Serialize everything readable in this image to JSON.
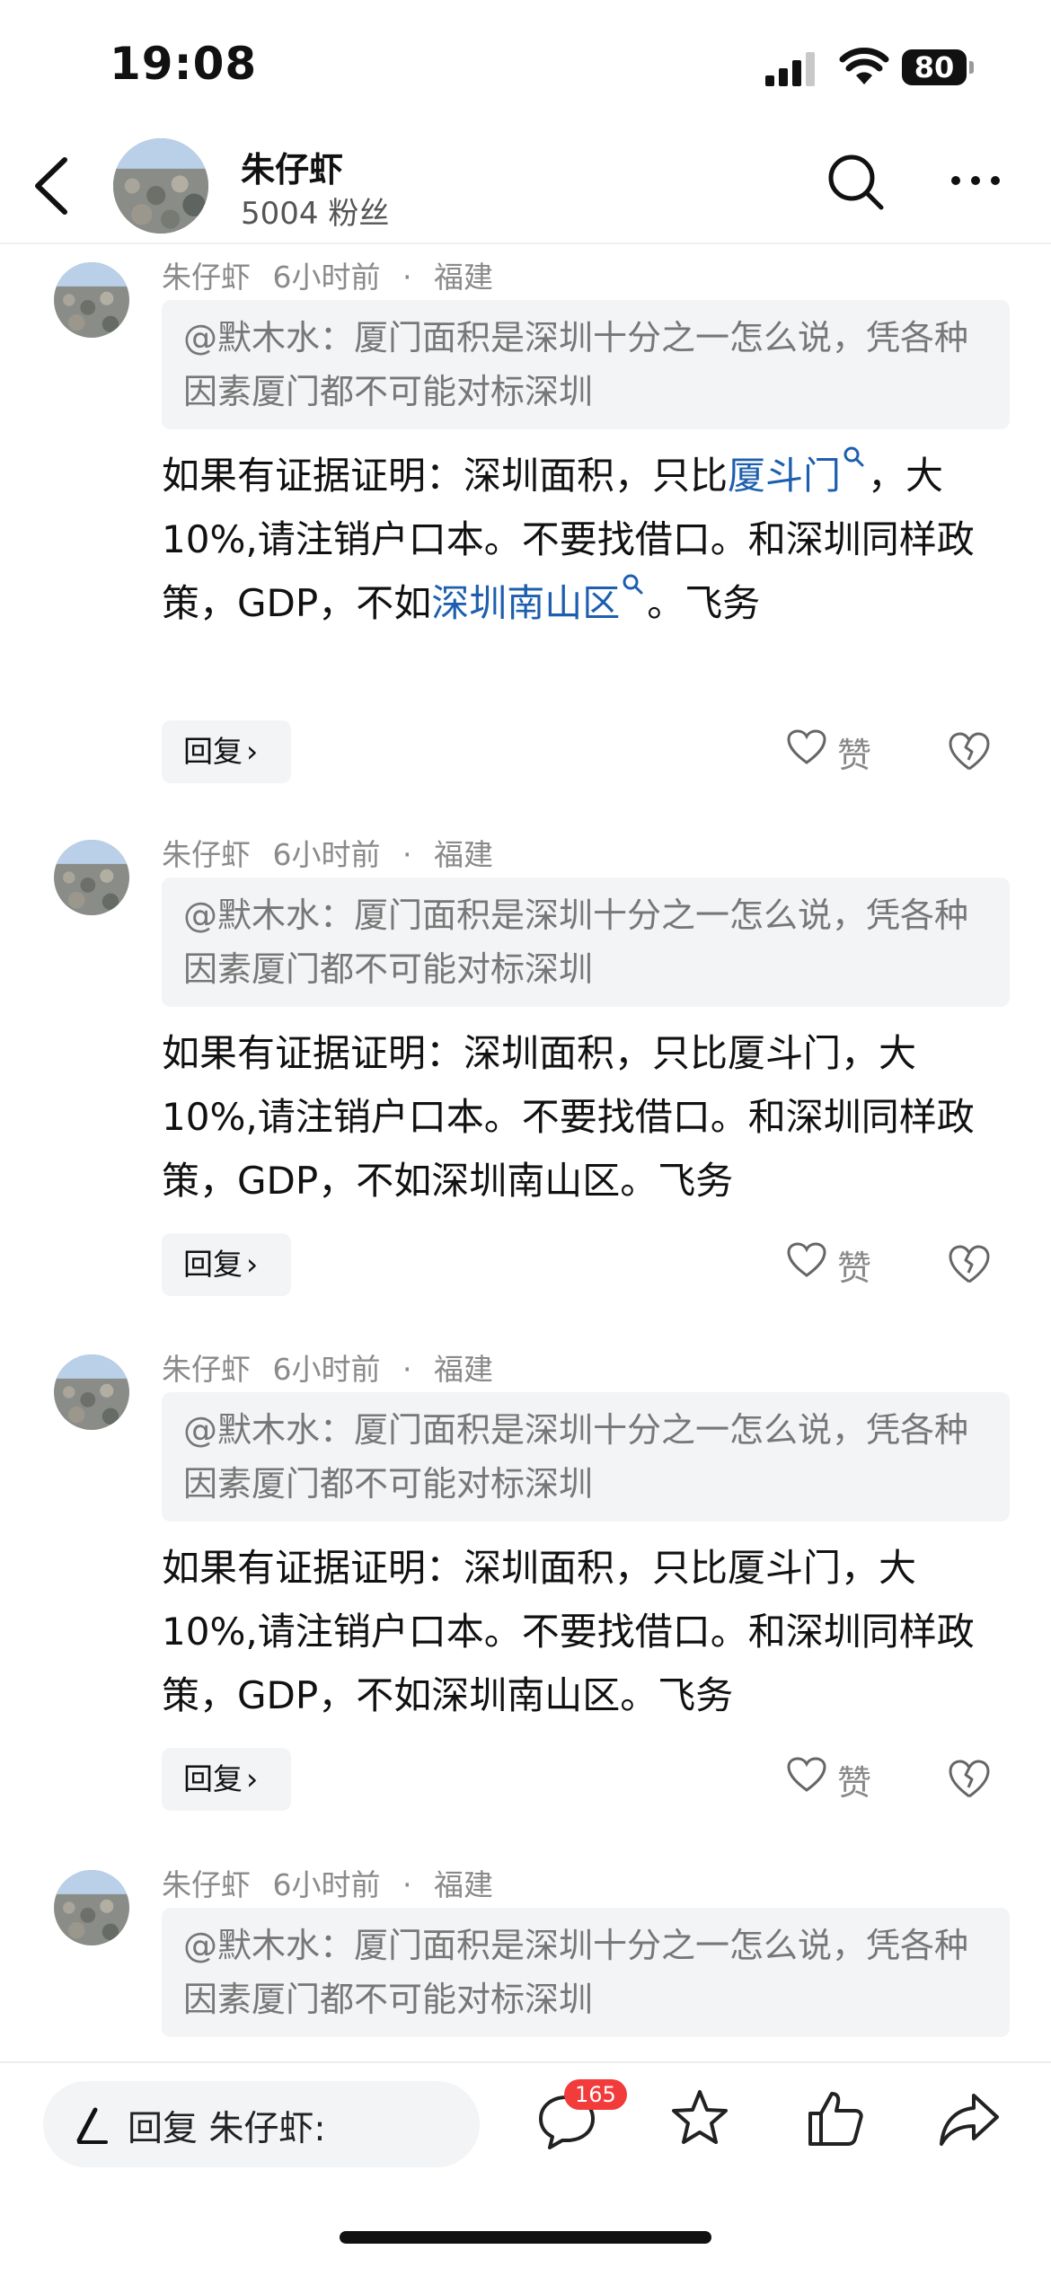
{
  "status": {
    "time": "19:08",
    "battery": "80"
  },
  "header": {
    "name": "朱仔虾",
    "fans": "5004 粉丝"
  },
  "comments": [
    {
      "author": "朱仔虾",
      "time": "6小时前",
      "location": "福建",
      "quote": "@默木水：厦门面积是深圳十分之一怎么说，凭各种因素厦门都不可能对标深圳",
      "body_p1": "如果有证据证明：深圳面积，只比",
      "body_link1": "厦斗门",
      "body_p2": "，大10%,请注销户口本。不要找借口。和深圳同样政策，GDP，不如",
      "body_link2": "深圳南山区",
      "body_p3": "。飞务",
      "reply_label": "回复",
      "like_label": "赞"
    },
    {
      "author": "朱仔虾",
      "time": "6小时前",
      "location": "福建",
      "quote": "@默木水：厦门面积是深圳十分之一怎么说，凭各种因素厦门都不可能对标深圳",
      "body": "如果有证据证明：深圳面积，只比厦斗门，大10%,请注销户口本。不要找借口。和深圳同样政策，GDP，不如深圳南山区。飞务",
      "reply_label": "回复",
      "like_label": "赞"
    },
    {
      "author": "朱仔虾",
      "time": "6小时前",
      "location": "福建",
      "quote": "@默木水：厦门面积是深圳十分之一怎么说，凭各种因素厦门都不可能对标深圳",
      "body": "如果有证据证明：深圳面积，只比厦斗门，大10%,请注销户口本。不要找借口。和深圳同样政策，GDP，不如深圳南山区。飞务",
      "reply_label": "回复",
      "like_label": "赞"
    },
    {
      "author": "朱仔虾",
      "time": "6小时前",
      "location": "福建",
      "quote": "@默木水：厦门面积是深圳十分之一怎么说，凭各种因素厦门都不可能对标深圳"
    }
  ],
  "bottom": {
    "reply_placeholder": "回复 朱仔虾:",
    "comment_count": "165"
  },
  "icons": [
    "back-icon",
    "search-icon",
    "more-icon",
    "heart-icon",
    "broken-heart-icon",
    "pen-icon",
    "comment-icon",
    "star-icon",
    "thumb-up-icon",
    "share-icon"
  ],
  "colors": {
    "link": "#1d5fae",
    "badge": "#f23b3b",
    "quote_bg": "#f3f4f6"
  }
}
